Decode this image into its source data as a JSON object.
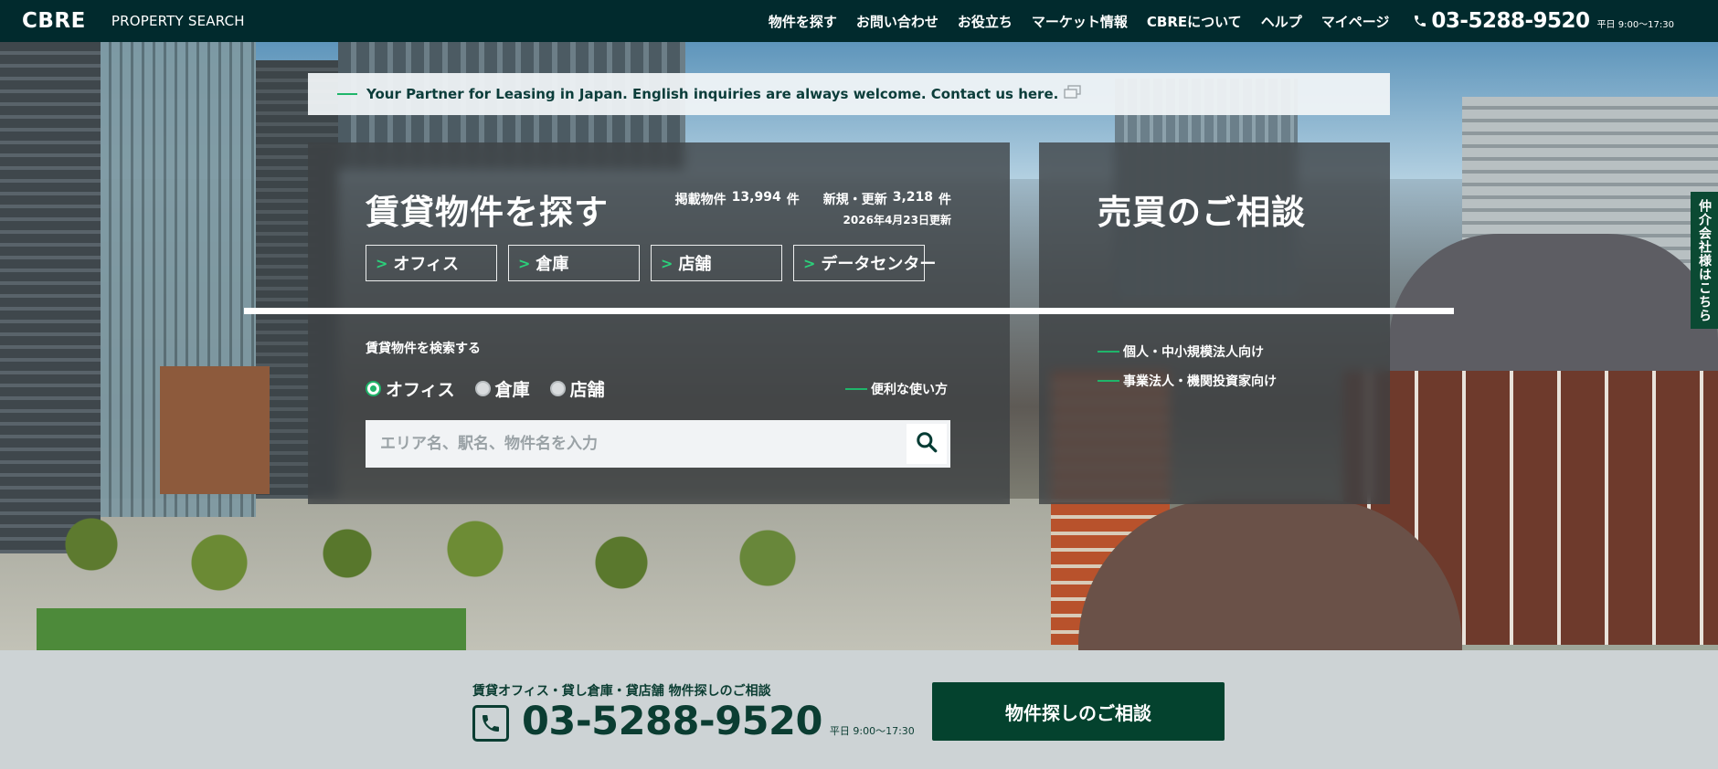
{
  "header": {
    "logo": "CBRE",
    "site_name": "PROPERTY SEARCH",
    "nav": [
      "物件を探す",
      "お問い合わせ",
      "お役立ち",
      "マーケット情報",
      "CBREについて",
      "ヘルプ",
      "マイページ"
    ],
    "phone": "03-5288-9520",
    "hours": "平日 9:00〜17:30",
    "phone_icon": "phone-icon"
  },
  "banner": {
    "text": "Your Partner for Leasing in Japan. English inquiries are always welcome. Contact us here.",
    "icon": "external-link-icon"
  },
  "lease_panel": {
    "title": "賃貸物件を探す",
    "listed_label": "掲載物件",
    "listed_count": "13,994",
    "listed_unit": "件",
    "new_label": "新規・更新",
    "new_count": "3,218",
    "new_unit": "件",
    "updated": "2026年4月23日更新",
    "categories": [
      "オフィス",
      "倉庫",
      "店舗",
      "データセンター"
    ],
    "search_label": "賃貸物件を検索する",
    "radio_options": [
      "オフィス",
      "倉庫",
      "店舗"
    ],
    "radio_selected": "オフィス",
    "howto": "便利な使い方",
    "search_placeholder": "エリア名、駅名、物件名を入力",
    "search_icon": "search-icon"
  },
  "sale_panel": {
    "title": "売買のご相談",
    "links": [
      "個人・中小規模法人向け",
      "事業法人・機関投資家向け"
    ]
  },
  "broker_tab": "仲介会社様はこちら",
  "contact": {
    "subtitle": "賃貸オフィス・貸し倉庫・貸店舗 物件探しのご相談",
    "phone": "03-5288-9520",
    "hours": "平日 9:00〜17:30",
    "button": "物件探しのご相談"
  },
  "colors": {
    "header_bg": "#012a2d",
    "accent_green": "#1fb56a",
    "dark_green": "#04422e",
    "footer_bg": "#cdd3d5"
  }
}
